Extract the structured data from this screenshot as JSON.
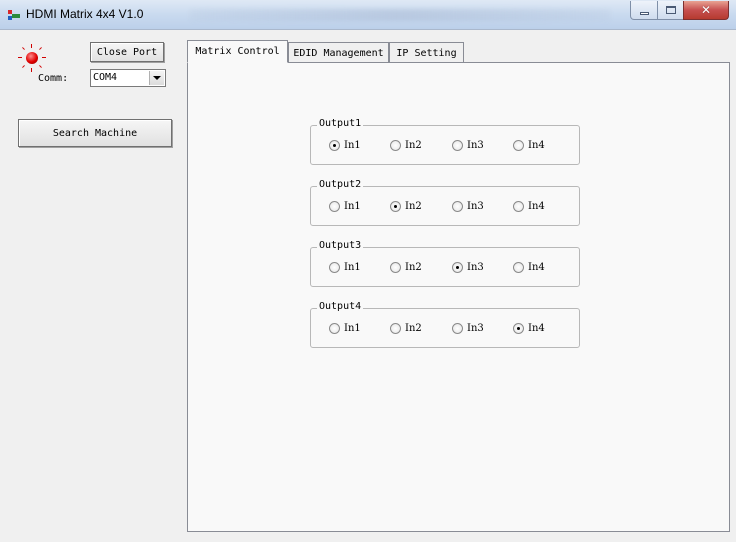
{
  "window": {
    "title": "HDMI Matrix 4x4 V1.0"
  },
  "left_panel": {
    "close_port_label": "Close Port",
    "comm_label": "Comm:",
    "comm_value": "COM4",
    "search_label": "Search Machine"
  },
  "tabs": [
    {
      "label": "Matrix Control",
      "active": true
    },
    {
      "label": "EDID Management",
      "active": false
    },
    {
      "label": "IP Setting",
      "active": false
    }
  ],
  "outputs": [
    {
      "title": "Output1",
      "options": [
        "In1",
        "In2",
        "In3",
        "In4"
      ],
      "selected": "In1"
    },
    {
      "title": "Output2",
      "options": [
        "In1",
        "In2",
        "In3",
        "In4"
      ],
      "selected": "In2"
    },
    {
      "title": "Output3",
      "options": [
        "In1",
        "In2",
        "In3",
        "In4"
      ],
      "selected": "In3"
    },
    {
      "title": "Output4",
      "options": [
        "In1",
        "In2",
        "In3",
        "In4"
      ],
      "selected": "In4"
    }
  ],
  "colors": {
    "status_led": "#e00000",
    "titlebar": "#c9daef",
    "close_button": "#c75050"
  },
  "icons": {
    "app": "app-icon",
    "status": "status-led-icon",
    "minimize": "minimize-icon",
    "maximize": "maximize-icon",
    "close": "close-icon",
    "dropdown": "chevron-down-icon"
  }
}
